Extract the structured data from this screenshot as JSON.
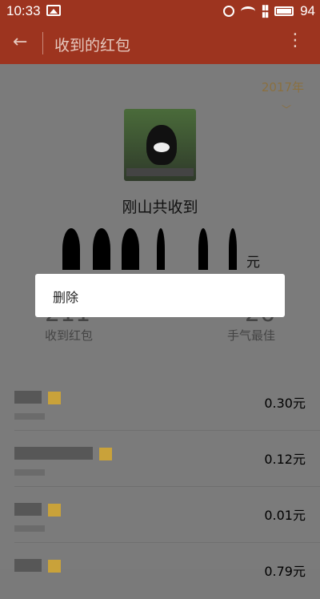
{
  "status_bar": {
    "time": "10:33",
    "battery": "94"
  },
  "appbar": {
    "title": "收到的红包"
  },
  "summary": {
    "year": "2017年",
    "name": "刚山共收到",
    "currency": "元",
    "received_label": "收到红包",
    "best_luck_label": "手气最佳",
    "received_count": "211",
    "best_luck_count": "26"
  },
  "dialog": {
    "delete_label": "删除"
  },
  "records": [
    {
      "amount": "0.30元"
    },
    {
      "amount": "0.12元"
    },
    {
      "amount": "0.01元"
    },
    {
      "amount": "0.79元"
    }
  ]
}
